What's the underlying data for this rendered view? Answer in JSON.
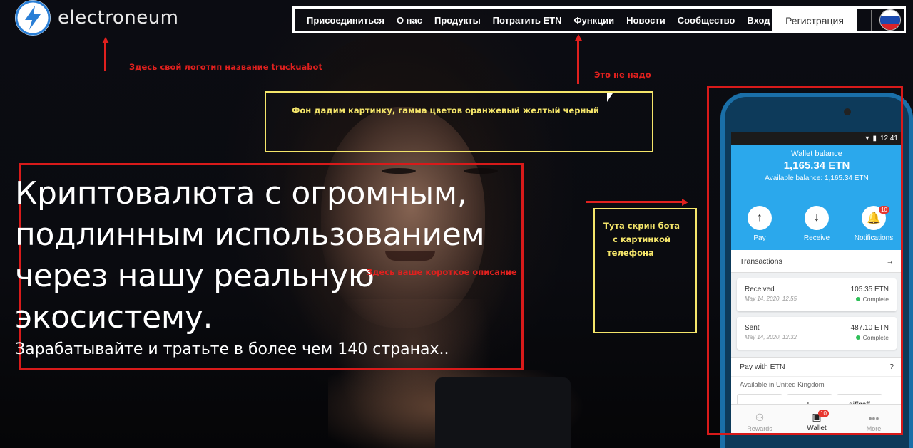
{
  "brand": {
    "name": "electroneum",
    "logo_icon": "lightning-bolt-icon"
  },
  "nav": {
    "items": [
      "Присоединиться",
      "О нас",
      "Продукты",
      "Потратить ETN",
      "Функции",
      "Новости",
      "Сообщество",
      "Вход"
    ],
    "register_label": "Регистрация",
    "flag_icon": "russia-flag-icon"
  },
  "annotations": {
    "logo_note": "Здесь свой логотип название truckuabot",
    "nav_note": "Это не надо",
    "background_note": "Фон дадим картинку, гамма цветов оранжевый желтый черный",
    "description_note": "Здесь ваше короткое описание",
    "phone_note_lines": [
      "Тута скрин бота",
      "с картинкой",
      "телефона"
    ]
  },
  "hero": {
    "title_lines": [
      "Криптовалюта с огромным,",
      "подлинным использованием",
      "через нашу реальную",
      "экосистему."
    ],
    "subtitle": "Зарабатывайте и тратьте в более чем 140 странах.."
  },
  "phone": {
    "time": "12:41",
    "wallet_label": "Wallet balance",
    "balance": "1,165.34 ETN",
    "available": "Available balance: 1,165.34 ETN",
    "actions": [
      {
        "label": "Pay",
        "icon": "arrow-up-icon"
      },
      {
        "label": "Receive",
        "icon": "arrow-down-icon"
      },
      {
        "label": "Notifications",
        "icon": "bell-icon",
        "badge": "10"
      }
    ],
    "transactions_label": "Transactions",
    "transactions": [
      {
        "type": "Received",
        "date": "May 14, 2020, 12:55",
        "amount": "105.35 ETN",
        "status": "Complete"
      },
      {
        "type": "Sent",
        "date": "May 14, 2020, 12:32",
        "amount": "487.10 ETN",
        "status": "Complete"
      }
    ],
    "pay_with": "Pay with ETN",
    "available_in": "Available in United Kingdom",
    "merchants": [
      "",
      "E",
      "giffgaff",
      ""
    ],
    "bottom_nav": [
      {
        "label": "Rewards",
        "icon": "rewards-icon"
      },
      {
        "label": "Wallet",
        "icon": "wallet-icon",
        "badge": "10"
      },
      {
        "label": "More",
        "icon": "more-icon"
      }
    ]
  },
  "colors": {
    "annotation_red": "#e0201e",
    "annotation_yellow": "#f4e56a",
    "wallet_blue": "#2ba8ec",
    "logo_blue": "#2a7fd6"
  }
}
